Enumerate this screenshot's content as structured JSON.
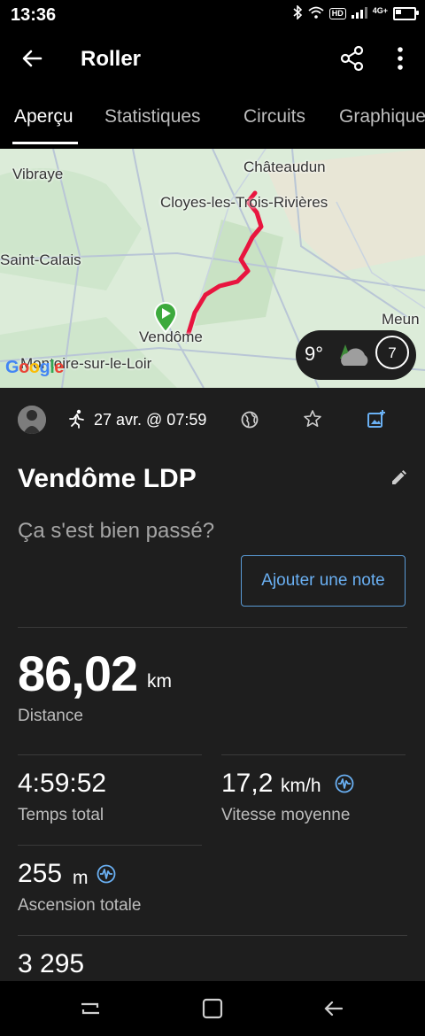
{
  "status_bar": {
    "time": "13:36",
    "network": "4G+"
  },
  "app_bar": {
    "title": "Roller"
  },
  "tabs": [
    {
      "label": "Aperçu",
      "active": true
    },
    {
      "label": "Statistiques",
      "active": false
    },
    {
      "label": "Circuits",
      "active": false
    },
    {
      "label": "Graphiques",
      "active": false
    }
  ],
  "map": {
    "places": [
      "Vibraye",
      "Châteaudun",
      "Cloyes-les-Trois-Rivières",
      "Saint-Calais",
      "Vendôme",
      "Montoire-sur-le-Loir",
      "Meun"
    ],
    "logo": "Google",
    "route_color": "#e8153f",
    "weather": {
      "temperature": "9°",
      "days": "7"
    }
  },
  "activity": {
    "date": "27 avr. @ 07:59",
    "name": "Vendôme LDP",
    "prompt": "Ça s'est bien passé?",
    "add_note_label": "Ajouter une note"
  },
  "stats": {
    "distance": {
      "value": "86,02",
      "unit": "km",
      "label": "Distance"
    },
    "total_time": {
      "value": "4:59:52",
      "label": "Temps total"
    },
    "avg_speed": {
      "value": "17,2",
      "unit": "km/h",
      "label": "Vitesse moyenne"
    },
    "ascent": {
      "value": "255",
      "unit": "m",
      "label": "Ascension totale"
    },
    "next": {
      "value": "3 295"
    }
  },
  "colors": {
    "accent": "#6ab0f3",
    "background": "#1e1e1e",
    "route": "#e8153f"
  }
}
